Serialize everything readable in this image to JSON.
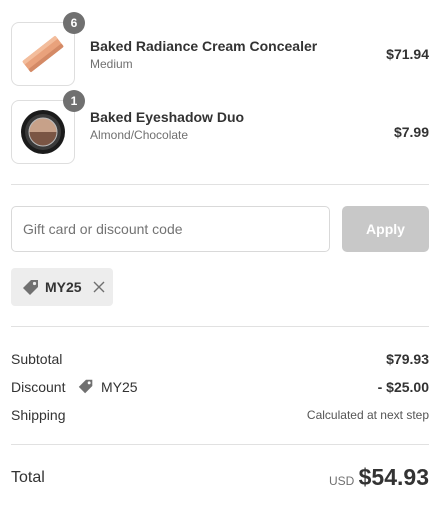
{
  "items": [
    {
      "name": "Baked Radiance Cream Concealer",
      "variant": "Medium",
      "quantity": "6",
      "price": "$71.94",
      "image": "concealer-swatch-image"
    },
    {
      "name": "Baked Eyeshadow Duo",
      "variant": "Almond/Chocolate",
      "quantity": "1",
      "price": "$7.99",
      "image": "eyeshadow-compact-image"
    }
  ],
  "discount_form": {
    "placeholder": "Gift card or discount code",
    "value": "",
    "apply_label": "Apply",
    "applied_code": "MY25"
  },
  "summary": {
    "subtotal_label": "Subtotal",
    "subtotal_value": "$79.93",
    "discount_label": "Discount",
    "discount_code": "MY25",
    "discount_value": "- $25.00",
    "shipping_label": "Shipping",
    "shipping_value": "Calculated at next step",
    "total_label": "Total",
    "currency": "USD",
    "total_value": "$54.93"
  },
  "colors": {
    "badge": "#707070",
    "apply_disabled": "#c8c8c8",
    "chip_bg": "#ededed",
    "divider": "#e1e1e1"
  }
}
